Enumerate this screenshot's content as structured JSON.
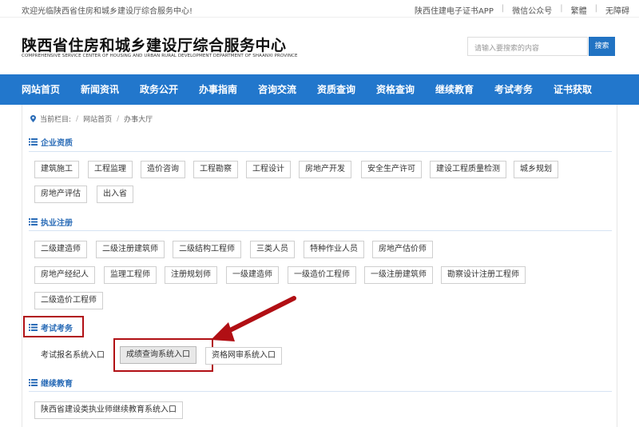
{
  "topbar": {
    "welcome": "欢迎光临陕西省住房和城乡建设厅综合服务中心!",
    "links": [
      "陕西住建电子证书APP",
      "微信公众号",
      "繁體",
      "无障碍"
    ]
  },
  "header": {
    "title_cn": "陕西省住房和城乡建设厅综合服务中心",
    "title_en": "COMPREHENSIVE SERVICE CENTER OF HOUSING AND URBAN RURAL DEVELOPMENT DEPARTMENT OF SHAANXI PROVINCE",
    "search_placeholder": "请输入要搜索的内容",
    "search_button": "搜索"
  },
  "nav": [
    "网站首页",
    "新闻资讯",
    "政务公开",
    "办事指南",
    "咨询交流",
    "资质查询",
    "资格查询",
    "继续教育",
    "考试考务",
    "证书获取"
  ],
  "breadcrumb": {
    "label": "当前栏目:",
    "items": [
      "网站首页",
      "办事大厅"
    ]
  },
  "sections": {
    "enterprise": {
      "title": "企业资质",
      "items": [
        "建筑施工",
        "工程监理",
        "造价咨询",
        "工程勘察",
        "工程设计",
        "房地产开发",
        "安全生产许可",
        "建设工程质量检测",
        "城乡规划",
        "房地产评估",
        "出入省"
      ]
    },
    "practice": {
      "title": "执业注册",
      "items": [
        "二级建造师",
        "二级注册建筑师",
        "二级结构工程师",
        "三类人员",
        "特种作业人员",
        "房地产估价师",
        "房地产经纪人",
        "监理工程师",
        "注册规划师",
        "一级建造师",
        "一级造价工程师",
        "一级注册建筑师",
        "勘察设计注册工程师",
        "二级造价工程师"
      ]
    },
    "exam": {
      "title": "考试考务",
      "items": [
        "考试报名系统入口",
        "成绩查询系统入口",
        "资格网审系统入口"
      ]
    },
    "education": {
      "title": "继续教育",
      "items": [
        "陕西省建设类执业师继续教育系统入口"
      ]
    }
  },
  "colors": {
    "nav_bg": "#2277cc",
    "section_title": "#2a6cb7",
    "highlight": "#b10f14"
  }
}
